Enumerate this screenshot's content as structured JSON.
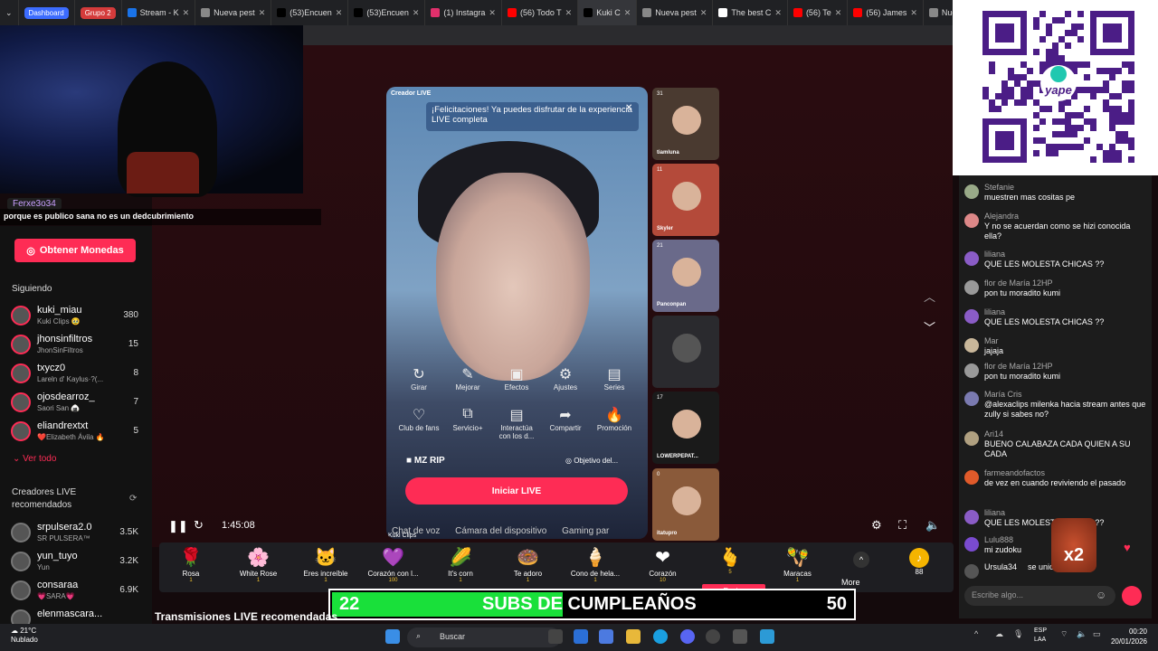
{
  "tabs": {
    "groups": [
      {
        "label": "Dashboard",
        "color": "#3c6cff"
      },
      {
        "label": "Grupo 2",
        "color": "#d43b3b"
      }
    ],
    "items": [
      {
        "label": "Stream - K",
        "color": "#1a73e8"
      },
      {
        "label": "Nueva pest",
        "color": "#888"
      },
      {
        "label": "(53)Encuen",
        "color": "#000"
      },
      {
        "label": "(53)Encuen",
        "color": "#000"
      },
      {
        "label": "(1) Instagra",
        "color": "#e1306c"
      },
      {
        "label": "(56) Todo T",
        "color": "#ff0000"
      },
      {
        "label": "Kuki C",
        "color": "#000"
      },
      {
        "label": "Nueva pest",
        "color": "#888"
      },
      {
        "label": "The best C",
        "color": "#fff"
      },
      {
        "label": "(56) Te",
        "color": "#ff0000"
      },
      {
        "label": "(56) James",
        "color": "#ff0000"
      },
      {
        "label": "Nueva pest",
        "color": "#888"
      }
    ]
  },
  "overlay": {
    "chat_user": "Ferxe3o34",
    "chat_msg": "porque es publico sana no es un dedcubrimiento"
  },
  "sidebar": {
    "coins_button": "Obtener Monedas",
    "following_title": "Siguiendo",
    "following": [
      {
        "name": "kuki_miau",
        "sub": "Kuki Clips 🥹",
        "count": "380"
      },
      {
        "name": "jhonsinfiltros",
        "sub": "JhonSinFiltros",
        "count": "15"
      },
      {
        "name": "txycz0",
        "sub": "Lareln d' Kaylus·?(...",
        "count": "8"
      },
      {
        "name": "ojosdearroz_",
        "sub": "Saori San 🍙",
        "count": "7"
      },
      {
        "name": "eliandrextxt",
        "sub": "❤️Elizabeth Ávila 🔥",
        "count": "5"
      }
    ],
    "see_all": "Ver todo",
    "recommended_title": "Creadores LIVE recomendados",
    "recommended": [
      {
        "name": "srpulsera2.0",
        "sub": "SR PULSERA™ ",
        "count": "3.5K"
      },
      {
        "name": "yun_tuyo",
        "sub": "Yun",
        "count": "3.2K"
      },
      {
        "name": "consaraa",
        "sub": "💗SARA💗",
        "count": "6.9K"
      },
      {
        "name": "elenmascara...",
        "sub": "",
        "count": ""
      }
    ]
  },
  "stage": {
    "creator_tag": "Creador LIVE",
    "congrats": "¡Felicitaciones! Ya puedes disfrutar de la experiencia LIVE completa",
    "tools": [
      {
        "label": "Girar",
        "icon": "↻"
      },
      {
        "label": "Mejorar",
        "icon": "✎"
      },
      {
        "label": "Efectos",
        "icon": "▣"
      },
      {
        "label": "Ajustes",
        "icon": "⚙"
      },
      {
        "label": "Series",
        "icon": "▤"
      },
      {
        "label": "Club de fans",
        "icon": "♡"
      },
      {
        "label": "Servicio+",
        "icon": "⧉"
      },
      {
        "label": "Interactúa con los d...",
        "icon": "▤"
      },
      {
        "label": "Compartir",
        "icon": "➦"
      },
      {
        "label": "Promoción",
        "icon": "🔥"
      }
    ],
    "room_name": "MZ RIP",
    "goal": "Objetivo del...",
    "start_button": "Iniciar LIVE",
    "options": [
      "Chat de voz",
      "Cámara del dispositivo",
      "Gaming par"
    ],
    "mini_label": "Kuki Clips",
    "time": "1:45:08"
  },
  "thumbs": [
    {
      "count": "31",
      "name": "tiamluna"
    },
    {
      "count": "11",
      "name": "Skyler"
    },
    {
      "count": "21",
      "name": "Panconpan"
    },
    {
      "count": "",
      "name": ""
    },
    {
      "count": "17",
      "name": "LOWERPEPAT..."
    },
    {
      "count": "0",
      "name": "itatupro"
    }
  ],
  "gifts": [
    {
      "name": "Rosa",
      "icon": "🌹",
      "price": "1"
    },
    {
      "name": "White Rose",
      "icon": "🌸",
      "price": "1"
    },
    {
      "name": "Eres increíble",
      "icon": "🐱",
      "price": "1"
    },
    {
      "name": "Corazón con l...",
      "icon": "💜",
      "price": "100"
    },
    {
      "name": "It's corn",
      "icon": "🌽",
      "price": "1"
    },
    {
      "name": "Te adoro",
      "icon": "🍩",
      "price": "1"
    },
    {
      "name": "Cono de hela...",
      "icon": "🍦",
      "price": "1"
    },
    {
      "name": "Corazón",
      "icon": "❤",
      "price": "10"
    },
    {
      "name": "",
      "icon": "🫰",
      "price": "5"
    },
    {
      "name": "Maracas",
      "icon": "🪇",
      "price": "1"
    }
  ],
  "gifts_more": "More",
  "coin_balance": "88",
  "send_label": "Enviar",
  "subs_banner": {
    "left": "22",
    "title": "SUBS DE CUMPLEAÑOS",
    "right": "50",
    "progress": 0.44
  },
  "recommended_streams": "Transmisiones LIVE recomendadas",
  "chat": [
    {
      "user": "Stefanie",
      "text": "muestren mas cositas pe",
      "color": "#9a8"
    },
    {
      "user": "Alejandra",
      "text": "Y no se acuerdan como se hizi conocida ella?",
      "color": "#d88"
    },
    {
      "user": "liliana",
      "text": "QUE LES MOLESTA CHICAS ??",
      "color": "#8a5cc6"
    },
    {
      "user": "flor de María 12HP",
      "text": "pon tu moradito kumi",
      "color": "#999"
    },
    {
      "user": "liliana",
      "text": "QUE LES MOLESTA CHICAS ??",
      "color": "#8a5cc6"
    },
    {
      "user": "Mar",
      "text": "jajaja",
      "color": "#c9b79a"
    },
    {
      "user": "flor de María 12HP",
      "text": "pon tu moradito kumi",
      "color": "#999"
    },
    {
      "user": "María Cris",
      "text": "@alexaclips milenka hacia stream antes que zully si sabes no?",
      "color": "#7a7ab0"
    },
    {
      "user": "Ari14",
      "text": "BUENO CALABAZA CADA QUIEN A SU CADA",
      "color": "#b0a080"
    },
    {
      "user": "farmeandofactos",
      "text": "de vez en cuando reviviendo el pasado",
      "color": "#e05a2a"
    },
    {
      "user": "liliana",
      "text": "QUE LES MOLESTA CHICAS ??",
      "color": "#8a5cc6"
    },
    {
      "user": "Lulu888",
      "text": "mi zudoku",
      "color": "#7a4bd0"
    },
    {
      "user": "Ursula34",
      "text": "se unió",
      "color": "#555"
    }
  ],
  "chat_input_placeholder": "Escribe algo...",
  "x2_label": "x2",
  "qr_label": "yape",
  "taskbar": {
    "temp": "21°C",
    "weather": "Nublado",
    "search": "Buscar",
    "lang1": "ESP",
    "lang2": "LAA",
    "time": "00:20",
    "date": "20/01/2026"
  }
}
